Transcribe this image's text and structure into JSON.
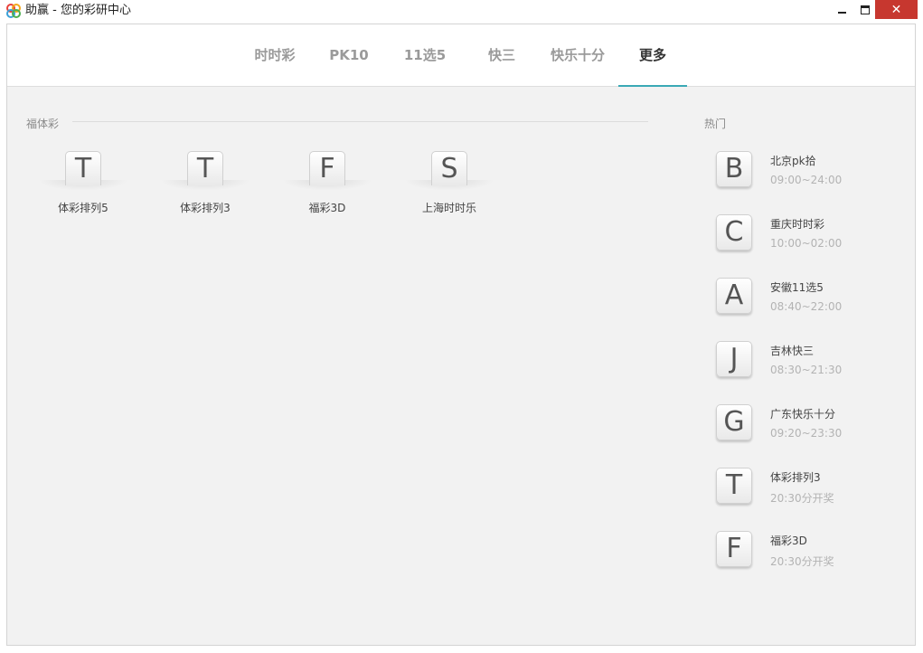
{
  "window": {
    "title": "助赢 - 您的彩研中心",
    "minimize_glyph": "",
    "close_glyph": "✕"
  },
  "tabs": [
    {
      "label": "时时彩"
    },
    {
      "label": "PK10"
    },
    {
      "label": "11选5"
    },
    {
      "label": "快三"
    },
    {
      "label": "快乐十分"
    },
    {
      "label": "更多",
      "active": true
    }
  ],
  "section": {
    "title": "福体彩",
    "items": [
      {
        "letter": "T",
        "label": "体彩排列5"
      },
      {
        "letter": "T",
        "label": "体彩排列3"
      },
      {
        "letter": "F",
        "label": "福彩3D"
      },
      {
        "letter": "S",
        "label": "上海时时乐"
      }
    ]
  },
  "hot": {
    "title": "热门",
    "items": [
      {
        "letter": "B",
        "name": "北京pk拾",
        "time": "09:00~24:00"
      },
      {
        "letter": "C",
        "name": "重庆时时彩",
        "time": "10:00~02:00"
      },
      {
        "letter": "A",
        "name": "安徽11选5",
        "time": "08:40~22:00"
      },
      {
        "letter": "J",
        "name": "吉林快三",
        "time": "08:30~21:30"
      },
      {
        "letter": "G",
        "name": "广东快乐十分",
        "time": "09:20~23:30"
      },
      {
        "letter": "T",
        "name": "体彩排列3",
        "time": "20:30分开奖"
      },
      {
        "letter": "F",
        "name": "福彩3D",
        "time": "20:30分开奖"
      }
    ]
  },
  "colors": {
    "accent": "#3aa9b5",
    "close_button": "#c7372f",
    "content_bg": "#f2f2f2"
  }
}
